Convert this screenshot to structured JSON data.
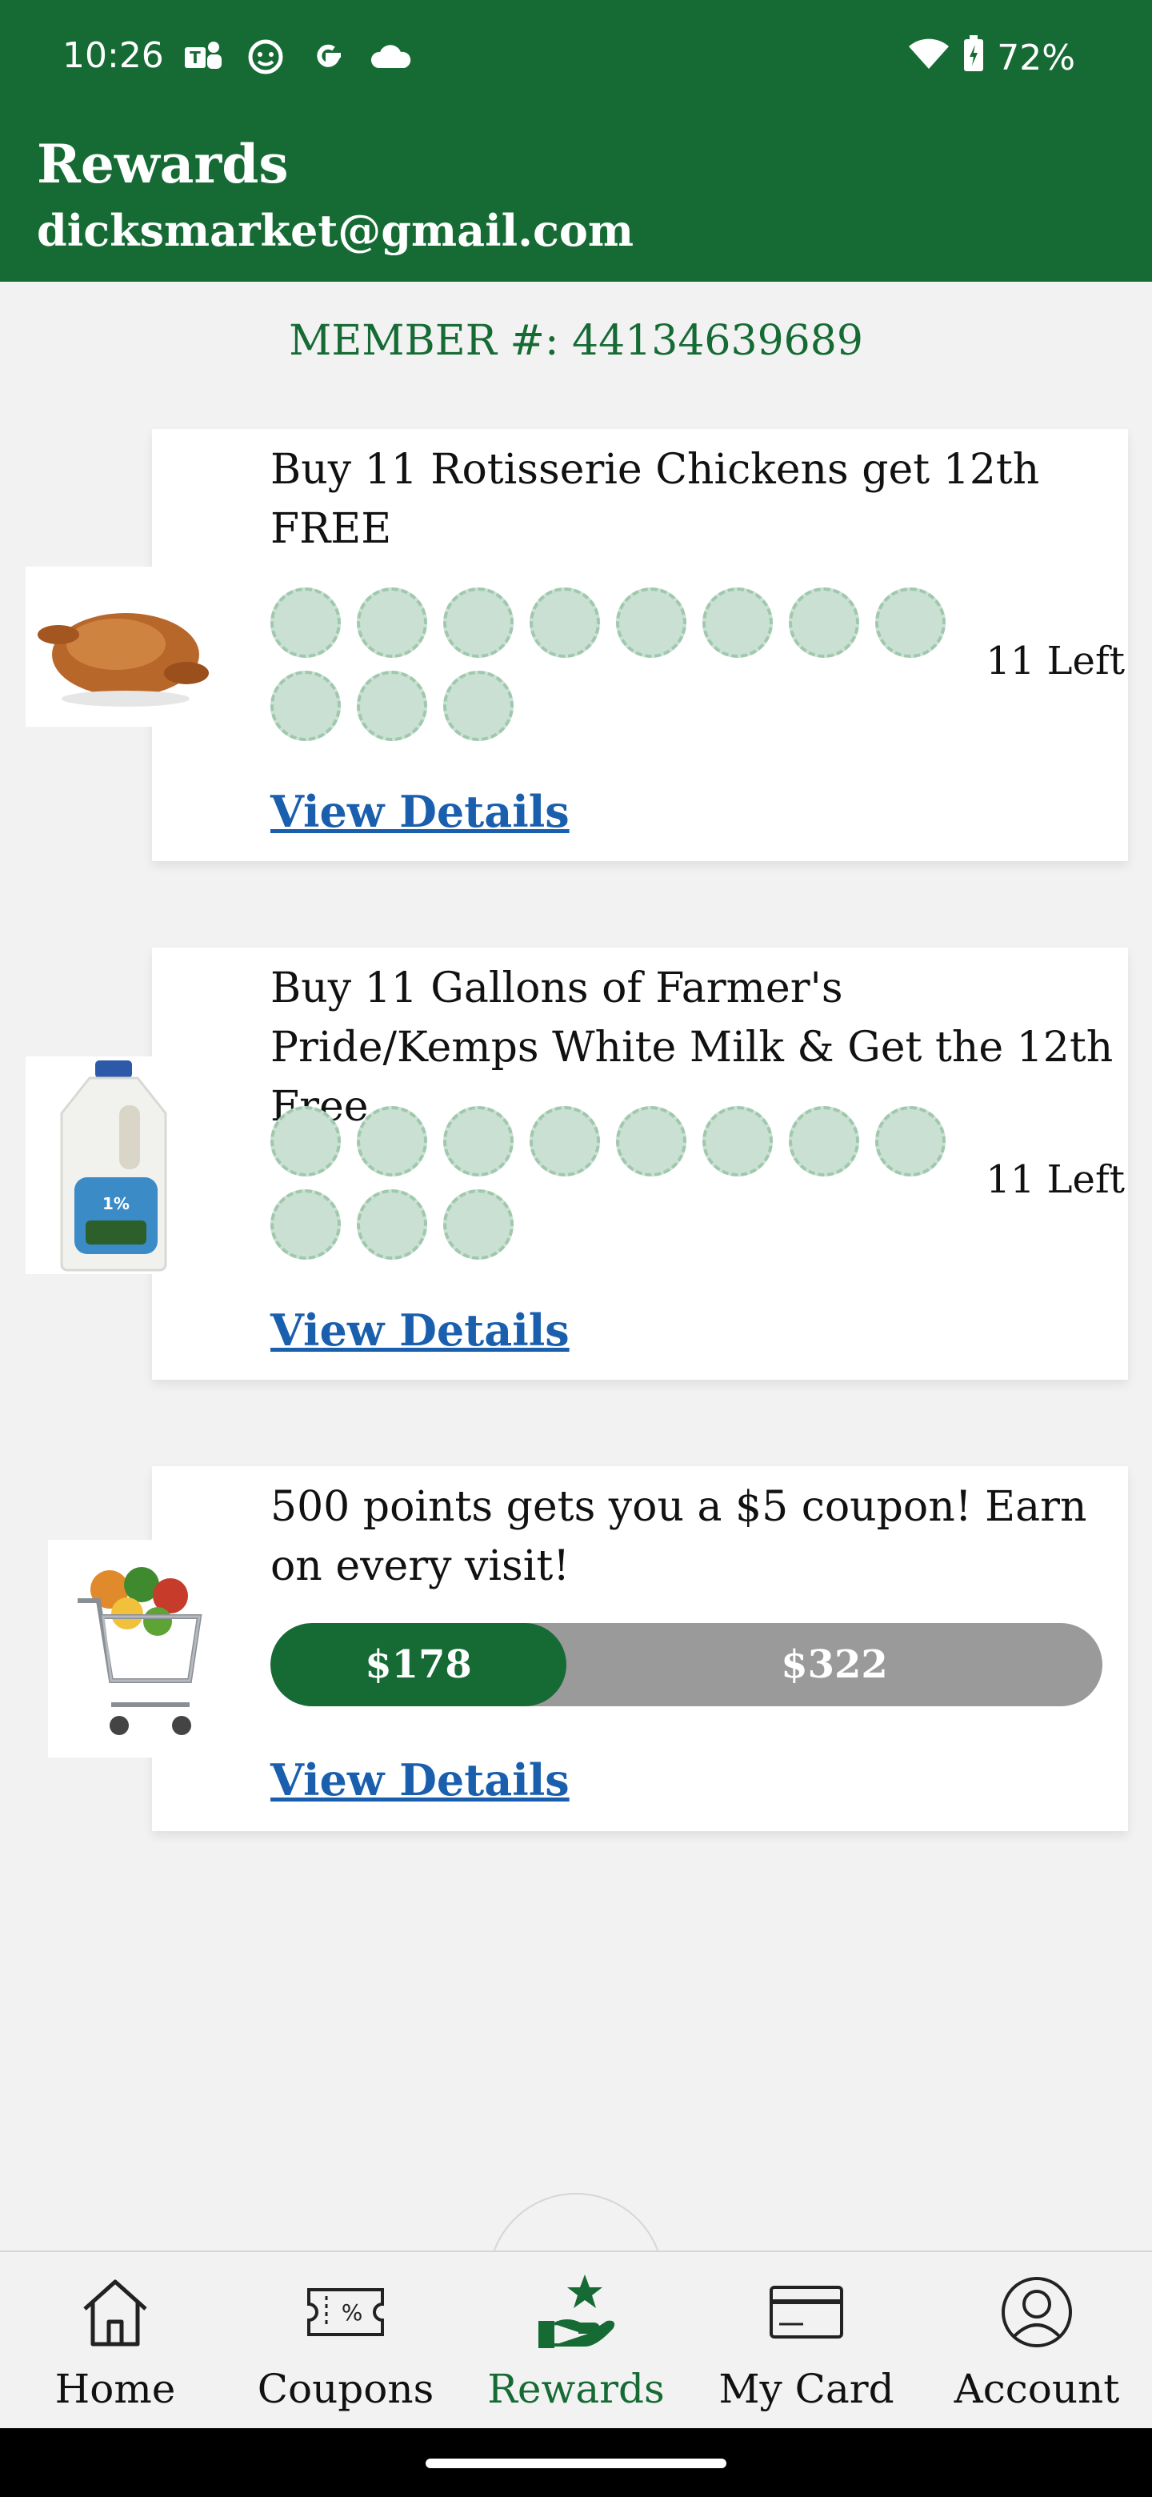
{
  "status_bar": {
    "time": "10:26",
    "battery": "72%",
    "left_icons": [
      "teams-icon",
      "notification-icon",
      "google-icon",
      "cloud-icon"
    ]
  },
  "header": {
    "title": "Rewards",
    "email": "dicksmarket@gmail.com"
  },
  "member": {
    "label": "MEMBER #: 44134639689"
  },
  "rewards": [
    {
      "title": "Buy 11 Rotisserie Chickens get 12th FREE",
      "image": "rotisserie-chicken",
      "punches_total": 11,
      "punches_filled": 0,
      "left_label": "11 Left",
      "details_label": "View Details"
    },
    {
      "title": "Buy 11 Gallons of Farmer's Pride/Kemps White Milk & Get the 12th Free",
      "image": "milk-gallon",
      "punches_total": 11,
      "punches_filled": 0,
      "left_label": "11 Left",
      "details_label": "View Details"
    },
    {
      "title": "500 points gets you a $5 coupon! Earn on every visit!",
      "image": "grocery-cart",
      "earned_label": "$178",
      "remaining_label": "$322",
      "progress_fraction": 0.356,
      "details_label": "View Details"
    }
  ],
  "nav": {
    "items": [
      {
        "label": "Home",
        "icon": "home-icon"
      },
      {
        "label": "Coupons",
        "icon": "coupon-icon"
      },
      {
        "label": "Rewards",
        "icon": "rewards-icon",
        "active": true
      },
      {
        "label": "My Card",
        "icon": "card-icon"
      },
      {
        "label": "Account",
        "icon": "account-icon"
      }
    ]
  },
  "colors": {
    "brand_green": "#166b35",
    "link_blue": "#1a5fae",
    "punch_empty": "#c9e0d2",
    "progress_track": "#9a9a9a"
  }
}
